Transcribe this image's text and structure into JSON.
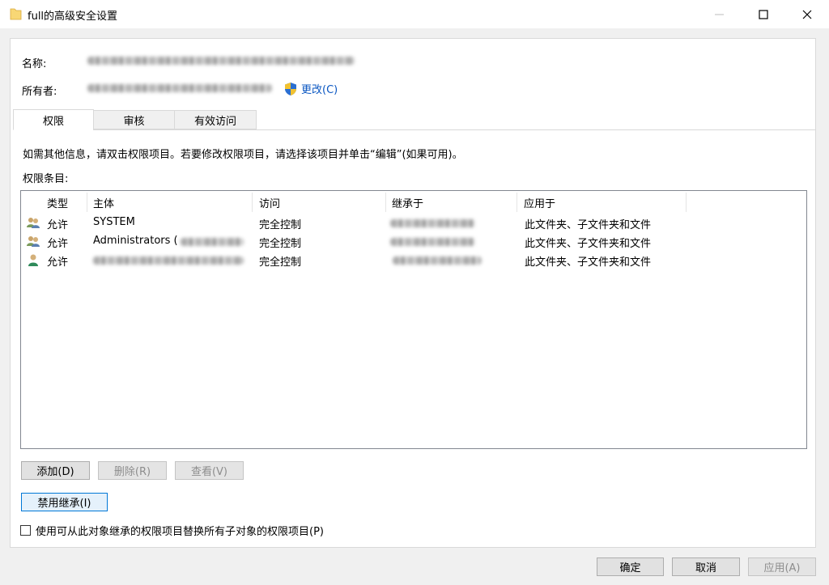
{
  "window": {
    "title": "full的高级安全设置"
  },
  "header": {
    "name_label": "名称:",
    "owner_label": "所有者:",
    "change_link": "更改(C)"
  },
  "tabs": [
    {
      "label": "权限",
      "active": true
    },
    {
      "label": "审核",
      "active": false
    },
    {
      "label": "有效访问",
      "active": false
    }
  ],
  "info_text": "如需其他信息，请双击权限项目。若要修改权限项目，请选择该项目并单击“编辑”(如果可用)。",
  "entries_label": "权限条目:",
  "table": {
    "columns": [
      "类型",
      "主体",
      "访问",
      "继承于",
      "应用于"
    ],
    "rows": [
      {
        "type": "允许",
        "principal": "SYSTEM",
        "access": "完全控制",
        "applies_to": "此文件夹、子文件夹和文件",
        "icon": "group-users-icon"
      },
      {
        "type": "允许",
        "principal": "Administrators (",
        "access": "完全控制",
        "applies_to": "此文件夹、子文件夹和文件",
        "icon": "group-users-icon"
      },
      {
        "type": "允许",
        "principal": "",
        "access": "完全控制",
        "applies_to": "此文件夹、子文件夹和文件",
        "icon": "single-user-icon"
      }
    ]
  },
  "buttons": {
    "add": "添加(D)",
    "remove": "删除(R)",
    "view": "查看(V)",
    "disable_inheritance": "禁用继承(I)",
    "ok": "确定",
    "cancel": "取消",
    "apply": "应用(A)"
  },
  "checkbox": {
    "label": "使用可从此对象继承的权限项目替换所有子对象的权限项目(P)",
    "checked": false
  },
  "colors": {
    "link": "#0b57c2",
    "focus_border": "#0078d7",
    "folder": "#f8d775"
  }
}
